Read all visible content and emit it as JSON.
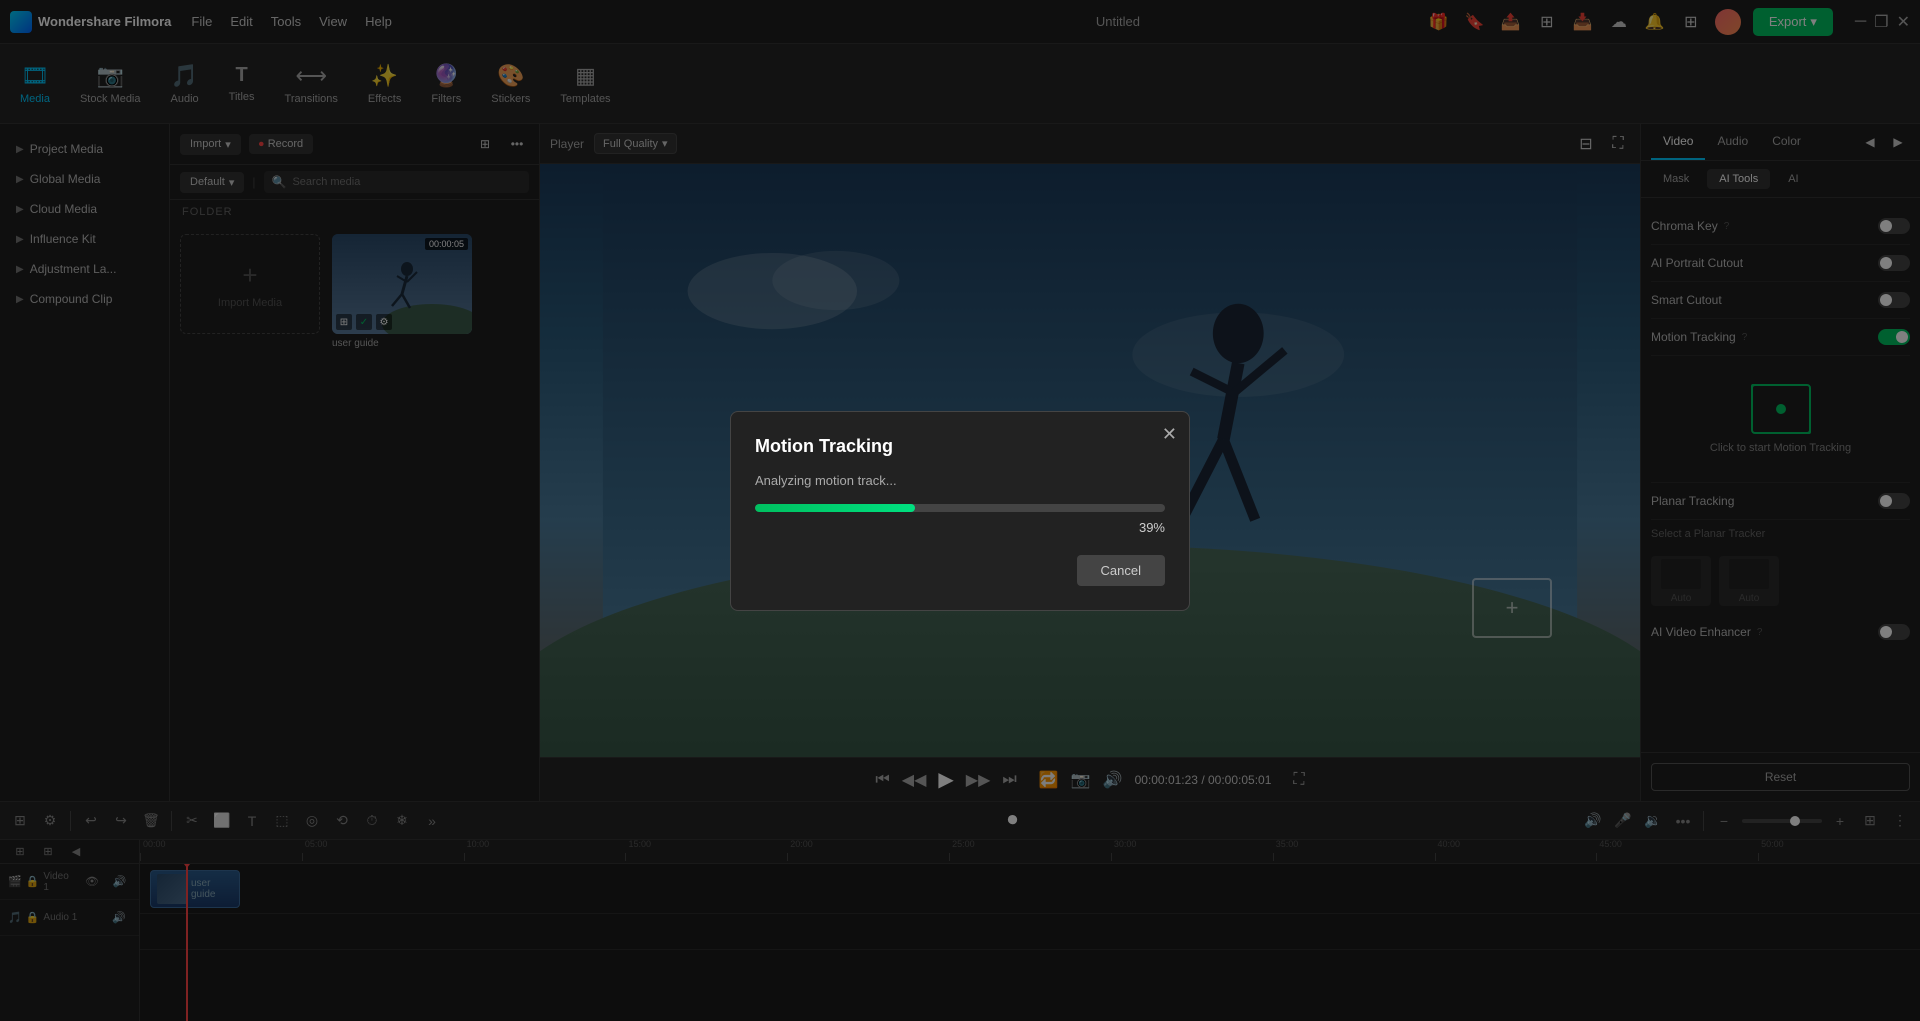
{
  "app": {
    "name": "Wondershare Filmora",
    "title": "Untitled"
  },
  "topbar": {
    "menu_items": [
      "File",
      "Edit",
      "Tools",
      "View",
      "Help"
    ],
    "export_label": "Export",
    "window_controls": [
      "─",
      "❐",
      "✕"
    ]
  },
  "toolbar": {
    "items": [
      {
        "id": "media",
        "icon": "🎞",
        "label": "Media",
        "active": true
      },
      {
        "id": "stock_media",
        "icon": "🎬",
        "label": "Stock Media"
      },
      {
        "id": "audio",
        "icon": "🎵",
        "label": "Audio"
      },
      {
        "id": "titles",
        "icon": "T",
        "label": "Titles"
      },
      {
        "id": "transitions",
        "icon": "⟷",
        "label": "Transitions"
      },
      {
        "id": "effects",
        "icon": "✨",
        "label": "Effects"
      },
      {
        "id": "filters",
        "icon": "🔮",
        "label": "Filters"
      },
      {
        "id": "stickers",
        "icon": "🎨",
        "label": "Stickers"
      },
      {
        "id": "templates",
        "icon": "▦",
        "label": "Templates"
      }
    ]
  },
  "left_sidebar": {
    "sections": [
      {
        "label": "Project Media",
        "arrow": "▶"
      },
      {
        "label": "Global Media",
        "arrow": "▶"
      },
      {
        "label": "Cloud Media",
        "arrow": "▶"
      },
      {
        "label": "Influence Kit",
        "arrow": "▶"
      },
      {
        "label": "Adjustment La...",
        "arrow": "▶"
      },
      {
        "label": "Compound Clip",
        "arrow": "▶"
      }
    ]
  },
  "media_panel": {
    "import_label": "Import",
    "record_label": "Record",
    "filter_icon": "⊞",
    "more_icon": "•••",
    "view_label": "Default",
    "search_placeholder": "Search media",
    "folder_label": "FOLDER",
    "items": [
      {
        "type": "import_placeholder",
        "label": "Import Media"
      },
      {
        "type": "thumb",
        "name": "user guide",
        "duration": "00:00:05"
      }
    ]
  },
  "preview": {
    "player_label": "Player",
    "quality_label": "Full Quality",
    "time_current": "00:00:01:23",
    "time_total": "00:00:05:01"
  },
  "right_panel": {
    "tabs": [
      "Video",
      "Audio",
      "Color"
    ],
    "sub_tabs": [
      "Mask",
      "AI Tools",
      "AI"
    ],
    "active_tab": "Video",
    "active_sub_tab": "AI Tools",
    "toggles": [
      {
        "label": "Chroma Key",
        "help": "?",
        "on": false
      },
      {
        "label": "AI Portrait Cutout",
        "on": false
      },
      {
        "label": "Smart Cutout",
        "on": false
      },
      {
        "label": "Motion Tracking",
        "help": "?",
        "on": true
      }
    ],
    "click_to_start": "Click to start Motion Tracking",
    "planar_tracking_label": "Planar Tracking",
    "planar_tracking_on": false,
    "select_tracker_label": "Select a Planar Tracker",
    "ai_video_enhancer_label": "AI Video Enhancer",
    "ai_video_enhancer_help": "?",
    "ai_video_enhancer_on": false,
    "reset_label": "Reset"
  },
  "modal": {
    "title": "Motion Tracking",
    "subtitle": "Analyzing motion track...",
    "progress_percent": 39,
    "progress_label": "39%",
    "cancel_label": "Cancel",
    "close_label": "✕"
  },
  "timeline": {
    "ruler_marks": [
      "00:00",
      "00:00:05:00",
      "00:00:10:00",
      "00:00:15:00",
      "00:00:20:00",
      "00:00:25:00",
      "00:00:30:00",
      "00:00:35:00",
      "00:00:40:00",
      "00:00:45:00",
      "00:00:50:00"
    ],
    "playhead_time": "00:00",
    "track_labels": [
      {
        "icon": "▶",
        "label": "Video 1"
      },
      {
        "icon": "♪",
        "label": "Audio 1"
      }
    ],
    "clip_name": "user guide"
  }
}
